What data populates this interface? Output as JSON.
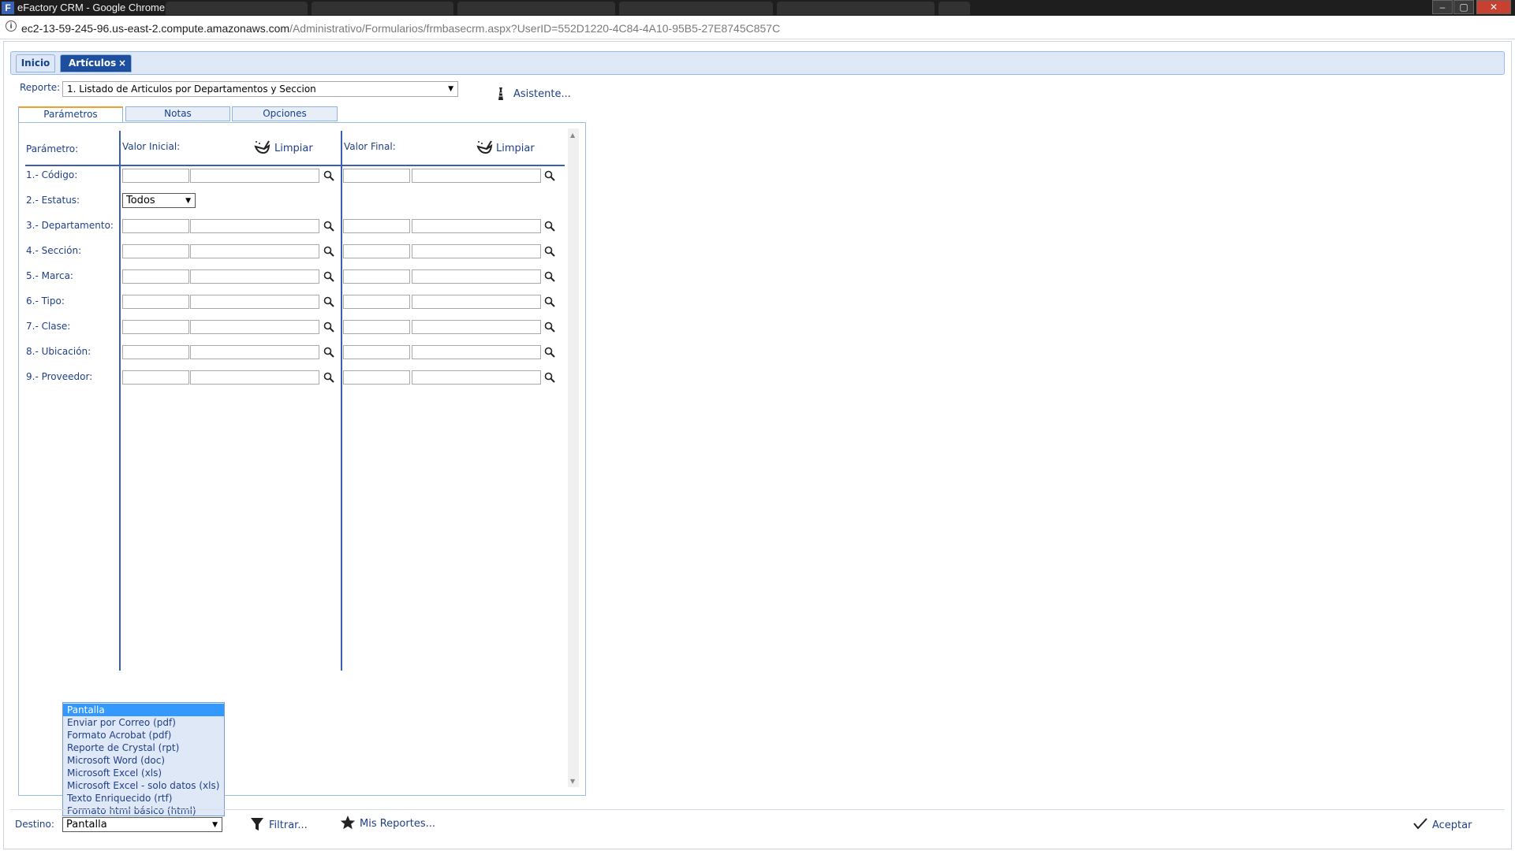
{
  "window": {
    "title": "eFactory CRM - Google Chrome",
    "controls": {
      "minimize": "‒",
      "maximize": "▢",
      "close": "✕"
    }
  },
  "address_bar": {
    "host": "ec2-13-59-245-96.us-east-2.compute.amazonaws.com",
    "path": "/Administrativo/Formularios/frmbasecrm.aspx?UserID=552D1220-4C84-4A10-95B5-27E8745C857C"
  },
  "tabs": {
    "inicio": "Inicio",
    "articulos": "Artículos",
    "close": "×"
  },
  "report": {
    "label": "Reporte:",
    "selected": "1. Listado de Articulos por Departamentos y Seccion",
    "assistant": "Asistente..."
  },
  "inner_tabs": {
    "params": "Parámetros",
    "notes": "Notas",
    "options": "Opciones"
  },
  "params": {
    "col_param": "Parámetro:",
    "col_initial": "Valor Inicial:",
    "col_final": "Valor Final:",
    "clear": "Limpiar",
    "rows": [
      "1.- Código:",
      "2.- Estatus:",
      "3.- Departamento:",
      "4.- Sección:",
      "5.- Marca:",
      "6.- Tipo:",
      "7.- Clase:",
      "8.- Ubicación:",
      "9.- Proveedor:"
    ],
    "status_value": "Todos"
  },
  "destination": {
    "label": "Destino:",
    "selected": "Pantalla",
    "options": [
      "Pantalla",
      "Enviar por Correo (pdf)",
      "Formato Acrobat (pdf)",
      "Reporte de Crystal (rpt)",
      "Microsoft Word (doc)",
      "Microsoft Excel (xls)",
      "Microsoft Excel - solo datos (xls)",
      "Texto Enriquecido (rtf)",
      "Formato html básico (html)"
    ]
  },
  "bottom": {
    "filter": "Filtrar...",
    "my_reports": "Mis Reportes...",
    "accept": "Aceptar"
  },
  "colors": {
    "label_blue": "#1f3f86",
    "active_tab": "#1d4f9e",
    "selected_option": "#3399ff",
    "dropdown_bg": "#dfe8f6"
  }
}
